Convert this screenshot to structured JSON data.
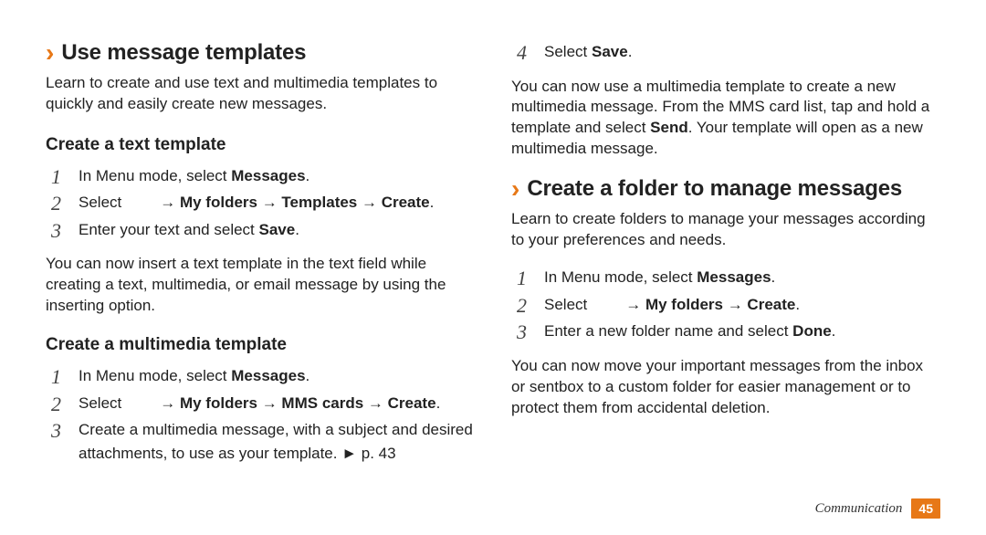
{
  "left": {
    "sec1": {
      "title": "Use message templates",
      "intro": "Learn to create and use text and multimedia templates to quickly and easily create new messages.",
      "sub1": "Create a text template",
      "s1_1a": "In Menu mode, select ",
      "s1_1b": "Messages",
      "s1_1c": ".",
      "s1_2a": "Select",
      "s1_2b": "→ My folders → Templates → Create",
      "s1_2c": ".",
      "s1_3a": "Enter your text and select ",
      "s1_3b": "Save",
      "s1_3c": ".",
      "after1": "You can now insert a text template in the text field while creating a text, multimedia, or email message by using the inserting option.",
      "sub2": "Create a multimedia template",
      "s2_1a": "In Menu mode, select ",
      "s2_1b": "Messages",
      "s2_1c": ".",
      "s2_2a": "Select",
      "s2_2b": "→ My folders → MMS cards → Create",
      "s2_2c": ".",
      "s2_3": "Create a multimedia message, with a subject and desired attachments, to use as your template. ► p. 43"
    }
  },
  "right": {
    "s2_4a": "Select ",
    "s2_4b": "Save",
    "s2_4c": ".",
    "after2a": "You can now use a multimedia template to create a new multimedia message. From the MMS card list, tap and hold a template and select ",
    "after2b": "Send",
    "after2c": ". Your template will open as a new multimedia message.",
    "sec2": {
      "title": "Create a folder to manage messages",
      "intro": "Learn to create folders to manage your messages according to your preferences and needs.",
      "s1a": "In Menu mode, select ",
      "s1b": "Messages",
      "s1c": ".",
      "s2a": "Select",
      "s2b": "→ My folders → Create",
      "s2c": ".",
      "s3a": "Enter a new folder name and select ",
      "s3b": "Done",
      "s3c": ".",
      "after": "You can now move your important messages from the inbox or sentbox to a custom folder for easier management or to protect them from accidental deletion."
    }
  },
  "footer": {
    "section": "Communication",
    "page": "45"
  }
}
